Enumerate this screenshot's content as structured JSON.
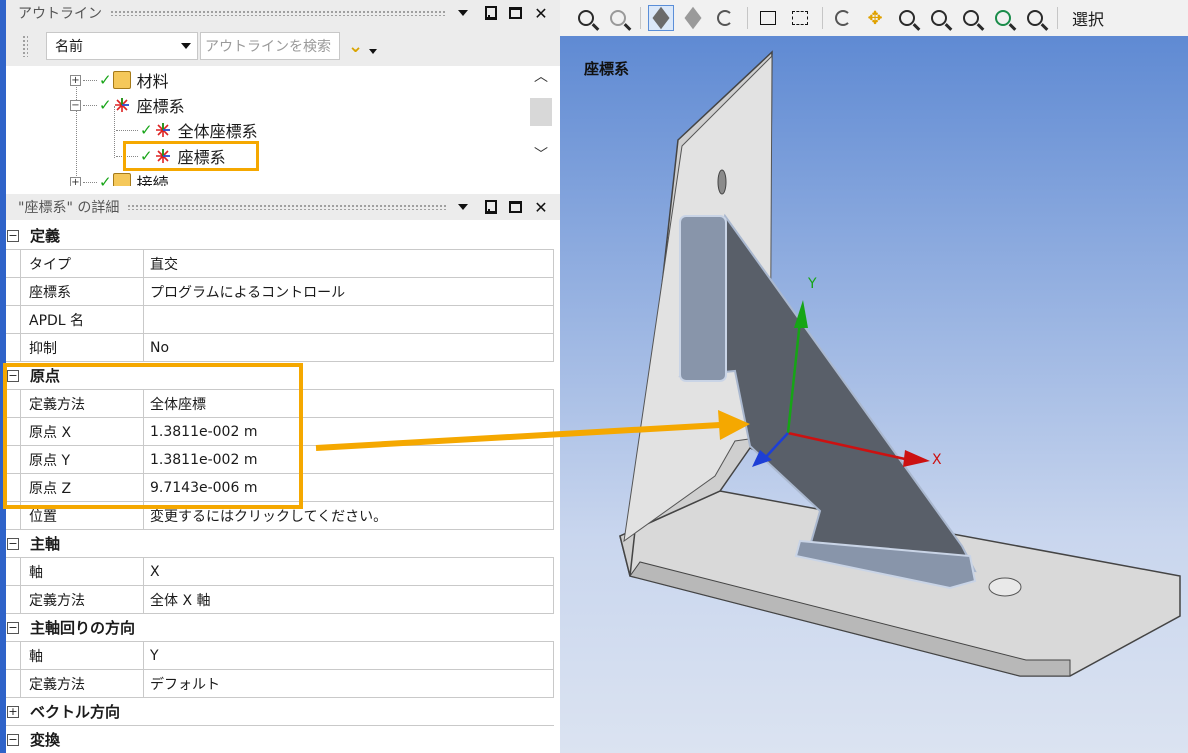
{
  "outline": {
    "title": "アウトライン",
    "name_select": "名前",
    "search_placeholder": "アウトラインを検索",
    "tree": [
      {
        "label": "材料"
      },
      {
        "label": "座標系"
      },
      {
        "label": "全体座標系"
      },
      {
        "label": "座標系"
      },
      {
        "label": "接続"
      }
    ]
  },
  "details": {
    "title": "\"座標系\" の詳細",
    "groups": [
      {
        "title": "定義",
        "rows": [
          [
            "タイプ",
            "直交"
          ],
          [
            "座標系",
            "プログラムによるコントロール"
          ],
          [
            "APDL 名",
            ""
          ],
          [
            "抑制",
            "No"
          ]
        ]
      },
      {
        "title": "原点",
        "rows": [
          [
            "定義方法",
            "全体座標"
          ],
          [
            "原点 X",
            "1.3811e-002 m"
          ],
          [
            "原点 Y",
            "1.3811e-002 m"
          ],
          [
            "原点 Z",
            "9.7143e-006 m"
          ],
          [
            "位置",
            "変更するにはクリックしてください。"
          ]
        ]
      },
      {
        "title": "主軸",
        "rows": [
          [
            "軸",
            "X"
          ],
          [
            "定義方法",
            "全体 X 軸"
          ]
        ]
      },
      {
        "title": "主軸回りの方向",
        "rows": [
          [
            "軸",
            "Y"
          ],
          [
            "定義方法",
            "デフォルト"
          ]
        ]
      },
      {
        "title": "ベクトル方向",
        "collapsed": true,
        "rows": []
      },
      {
        "title": "変換",
        "rows": []
      }
    ]
  },
  "viewport": {
    "title": "座標系",
    "axis_x": "X",
    "axis_y": "Y"
  },
  "toolbar": {
    "select_label": "選択"
  },
  "colors": {
    "highlight": "#f5a800",
    "viewport_top": "#5f8ad3",
    "axis_x": "#cc1111",
    "axis_y": "#16a516",
    "axis_z": "#1d3fd6"
  }
}
